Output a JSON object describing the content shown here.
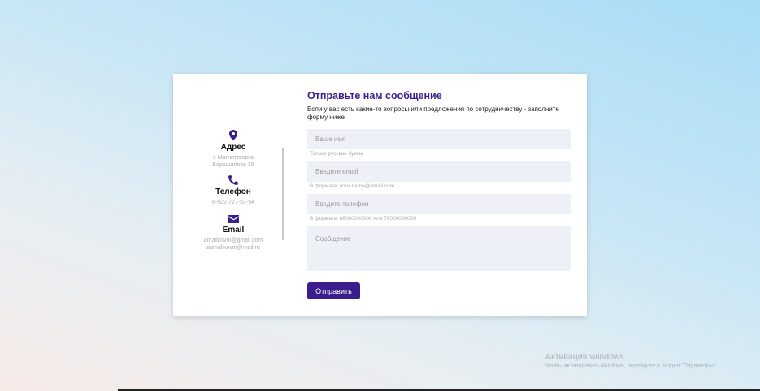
{
  "contacts": {
    "address": {
      "icon": "map-pin-icon",
      "title": "Адрес",
      "lines": [
        "г. Магнитогорск",
        "Ворошилова 15"
      ]
    },
    "phone": {
      "icon": "phone-icon",
      "title": "Телефон",
      "lines": [
        "8-922-727-51-54"
      ]
    },
    "email": {
      "icon": "envelope-icon",
      "title": "Email",
      "lines": [
        "amalikovm@gmail.com",
        "aamalikovm@mail.ru"
      ]
    }
  },
  "form": {
    "title": "Отправьте нам сообщение",
    "description": "Если у вас есть какие-то вопросы или предложения по сотрудничеству - заполните форму ниже",
    "name": {
      "placeholder": "Ваше имя",
      "hint": "Только русские буквы"
    },
    "email": {
      "placeholder": "Введите email",
      "hint": "В формате: your-name@email.com"
    },
    "phone": {
      "placeholder": "Введите телефон",
      "hint": "В формате: 88000000000 или 78000000000"
    },
    "message": {
      "placeholder": "Сообщение"
    },
    "submit_label": "Отправить"
  },
  "watermark": {
    "title": "Активация Windows",
    "text": "Чтобы активировать Windows, перейдите в раздел \"Параметры\"."
  },
  "colors": {
    "accent": "#3a1f8c",
    "field_bg": "#eef0f7"
  }
}
